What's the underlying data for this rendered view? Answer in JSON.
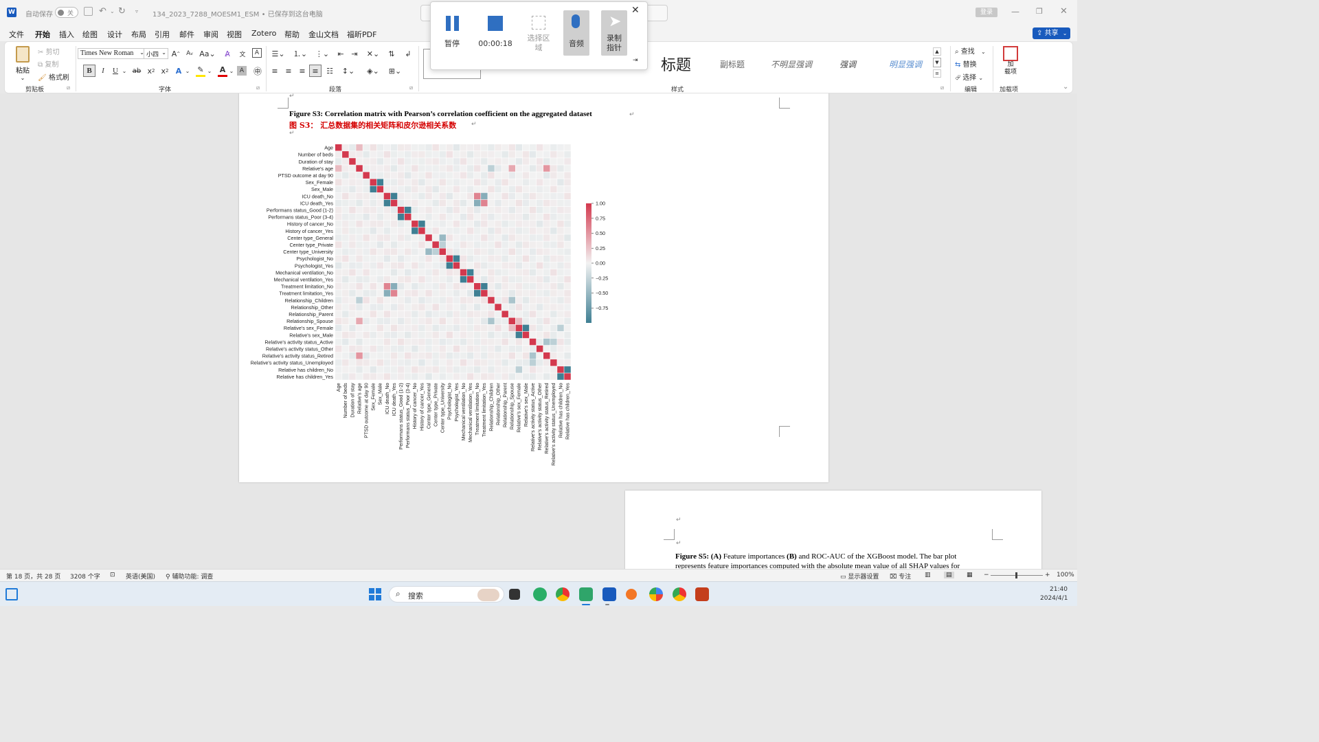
{
  "titlebar": {
    "app_icon": "W",
    "autosave_label": "自动保存",
    "autosave_toggle": "关",
    "doc_title": "134_2023_7288_MOESM1_ESM • 已保存到这台电脑",
    "login": "登录"
  },
  "menu": [
    "文件",
    "开始",
    "插入",
    "绘图",
    "设计",
    "布局",
    "引用",
    "邮件",
    "审阅",
    "视图",
    "Zotero",
    "帮助",
    "金山文档",
    "福昕PDF"
  ],
  "menu_active": "开始",
  "share": "共享",
  "ribbon": {
    "clipboard": {
      "paste": "粘贴",
      "cut": "剪切",
      "copy": "复制",
      "format_painter": "格式刷",
      "label": "剪贴板"
    },
    "font": {
      "name": "Times New Roman",
      "size": "小四",
      "label": "字体"
    },
    "paragraph": {
      "label": "段落"
    },
    "styles": {
      "items": [
        "标题",
        "副标题",
        "不明显强调",
        "强调",
        "明显强调"
      ],
      "label": "样式"
    },
    "editing": {
      "find": "查找",
      "replace": "替换",
      "select": "选择",
      "label": "编辑"
    },
    "addins": {
      "button": "加\n载项",
      "label": "加载项"
    }
  },
  "recorder": {
    "pause": "暂停",
    "time": "00:00:18",
    "select_area": "选择区域",
    "audio": "音频",
    "pointer": "录制指针"
  },
  "document": {
    "figure_s3_caption_en": "Figure S3: Correlation matrix with Pearson’s correlation coefficient on the aggregated dataset",
    "figure_s3_caption_zh": "图 S3：  汇总数据集的相关矩阵和皮尔逊相关系数",
    "figure_s5_bold1": "Figure S5:",
    "figure_s5_boldA": "(A)",
    "figure_s5_text1": "Feature importances",
    "figure_s5_boldB": "(B)",
    "figure_s5_text2": "and ROC-AUC of the XGBoost model. The bar plot",
    "figure_s5_line2": "represents feature importances computed with the absolute mean value of all SHAP values for"
  },
  "chart_data": {
    "type": "heatmap",
    "title": "",
    "variables": [
      "Age",
      "Number of beds",
      "Duration of stay",
      "Relative's age",
      "PTSD outcome at day 90",
      "Sex_Female",
      "Sex_Male",
      "ICU death_No",
      "ICU death_Yes",
      "Performans status_Good (1-2)",
      "Performans status_Poor (3-4)",
      "History of cancer_No",
      "History of cancer_Yes",
      "Center type_General",
      "Center type_Private",
      "Center type_University",
      "Psychologist_No",
      "Psychologist_Yes",
      "Mechanical ventilation_No",
      "Mechanical ventilation_Yes",
      "Treatment limitation_No",
      "Treatment limitation_Yes",
      "Relationship_Children",
      "Relationship_Other",
      "Relationship_Parent",
      "Relationship_Spouse",
      "Relative's sex_Female",
      "Relative's sex_Male",
      "Relative's activity status_Active",
      "Relative's activity status_Other",
      "Relative's activity status_Retired",
      "Relative's activity status_Unemployed",
      "Relative has children_No",
      "Relative has children_Yes"
    ],
    "colorbar": {
      "ticks": [
        "1.00",
        "0.75",
        "0.50",
        "0.25",
        "0.00",
        "−0.25",
        "−0.50",
        "−0.75"
      ],
      "range": [
        -1,
        1
      ]
    },
    "strong_pairs": [
      {
        "a": "Sex_Female",
        "b": "Sex_Male",
        "r": -1.0
      },
      {
        "a": "ICU death_No",
        "b": "ICU death_Yes",
        "r": -1.0
      },
      {
        "a": "Performans status_Good (1-2)",
        "b": "Performans status_Poor (3-4)",
        "r": -1.0
      },
      {
        "a": "History of cancer_No",
        "b": "History of cancer_Yes",
        "r": -1.0
      },
      {
        "a": "Psychologist_No",
        "b": "Psychologist_Yes",
        "r": -1.0
      },
      {
        "a": "Mechanical ventilation_No",
        "b": "Mechanical ventilation_Yes",
        "r": -1.0
      },
      {
        "a": "Treatment limitation_No",
        "b": "Treatment limitation_Yes",
        "r": -1.0
      },
      {
        "a": "Relative's sex_Female",
        "b": "Relative's sex_Male",
        "r": -1.0
      },
      {
        "a": "Relative has children_No",
        "b": "Relative has children_Yes",
        "r": -1.0
      },
      {
        "a": "ICU death_No",
        "b": "Treatment limitation_No",
        "r": 0.6
      },
      {
        "a": "ICU death_Yes",
        "b": "Treatment limitation_Yes",
        "r": 0.6
      },
      {
        "a": "ICU death_No",
        "b": "Treatment limitation_Yes",
        "r": -0.6
      },
      {
        "a": "ICU death_Yes",
        "b": "Treatment limitation_No",
        "r": -0.6
      },
      {
        "a": "Center type_General",
        "b": "Center type_University",
        "r": -0.5
      },
      {
        "a": "Center type_Private",
        "b": "Center type_University",
        "r": -0.3
      },
      {
        "a": "Relative's age",
        "b": "Relative's activity status_Retired",
        "r": 0.5
      },
      {
        "a": "Relative's age",
        "b": "Relationship_Spouse",
        "r": 0.4
      },
      {
        "a": "Relationship_Children",
        "b": "Relationship_Spouse",
        "r": -0.4
      },
      {
        "a": "Relationship_Spouse",
        "b": "Relative's sex_Female",
        "r": 0.3
      },
      {
        "a": "Relative's activity status_Active",
        "b": "Relative's activity status_Retired",
        "r": -0.4
      },
      {
        "a": "Relative's activity status_Active",
        "b": "Relative's activity status_Unemployed",
        "r": -0.3
      },
      {
        "a": "Age",
        "b": "Relative's age",
        "r": 0.3
      },
      {
        "a": "Relative's age",
        "b": "Relationship_Children",
        "r": -0.3
      },
      {
        "a": "Relative has children_No",
        "b": "Relative's sex_Female",
        "r": -0.3
      }
    ]
  },
  "statusbar": {
    "page": "第 18 页，共 28 页",
    "words": "3208 个字",
    "lang": "英语(美国)",
    "accessibility": "辅助功能: 调查",
    "display": "显示器设置",
    "focus": "专注",
    "zoom": "100%"
  },
  "taskbar": {
    "search": "搜索",
    "time": "21:40",
    "date": "2024/4/1"
  },
  "colors": {
    "accent": "#185abd",
    "heat_pos": "#d3394e",
    "heat_neg": "#3f7f93",
    "red_caption": "#d40000"
  }
}
